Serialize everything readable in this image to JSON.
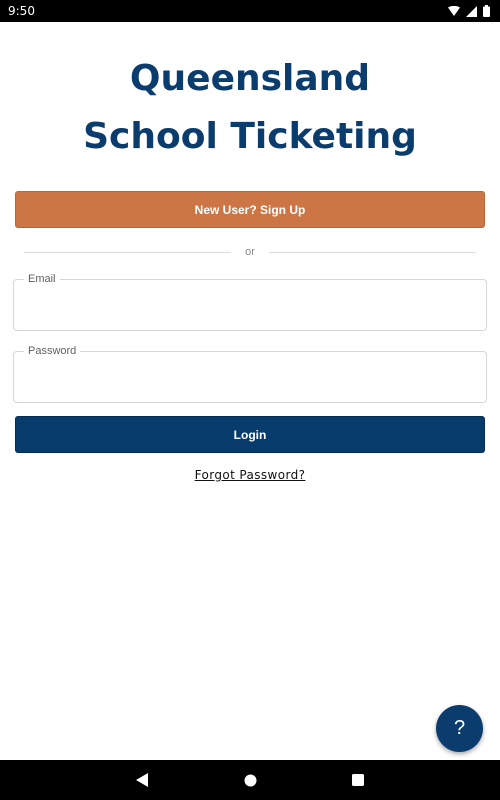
{
  "status_bar": {
    "time": "9:50"
  },
  "app": {
    "title_line1": "Queensland",
    "title_line2": "School Ticketing",
    "colors": {
      "brand_blue": "#0b3c6e",
      "signup_orange": "#cc7645",
      "login_navy": "#073b6b"
    }
  },
  "signup": {
    "label": "New User? Sign Up"
  },
  "divider": {
    "label": "or"
  },
  "email_field": {
    "label": "Email",
    "value": ""
  },
  "password_field": {
    "label": "Password",
    "value": ""
  },
  "login": {
    "label": "Login"
  },
  "forgot_password": {
    "label": "Forgot Password?"
  },
  "help": {
    "label": "?"
  },
  "icons": {
    "status": [
      "wifi-icon",
      "signal-icon",
      "battery-icon"
    ],
    "nav": [
      "back-icon",
      "home-icon",
      "recents-icon"
    ]
  }
}
